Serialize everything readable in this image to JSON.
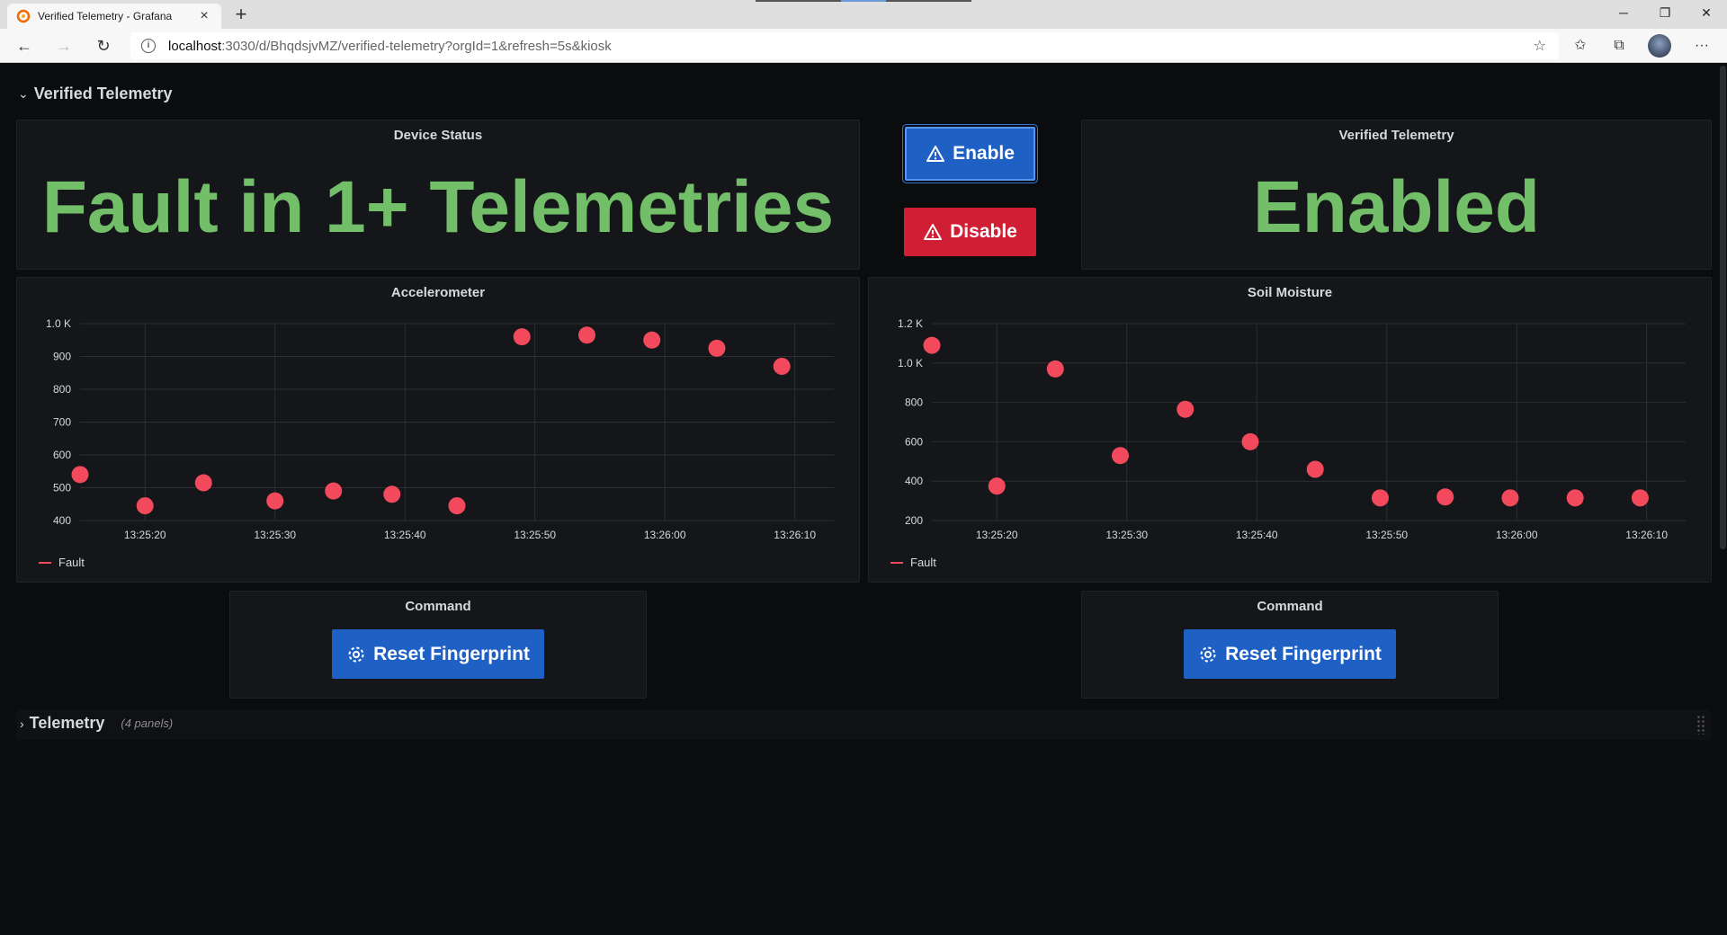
{
  "browser": {
    "tab_title": "Verified Telemetry - Grafana",
    "url_host": "localhost",
    "url_path": ":3030/d/BhqdsjvMZ/verified-telemetry?orgId=1&refresh=5s&kiosk"
  },
  "dashboard": {
    "row1_title": "Verified Telemetry",
    "row2_title": "Telemetry",
    "row2_count": "(4 panels)"
  },
  "device_status": {
    "title": "Device Status",
    "value": "Fault in 1+ Telemetries"
  },
  "buttons": {
    "enable": "Enable",
    "disable": "Disable"
  },
  "verified_telemetry": {
    "title": "Verified Telemetry",
    "value": "Enabled"
  },
  "command_left": {
    "title": "Command",
    "button": "Reset Fingerprint"
  },
  "command_right": {
    "title": "Command",
    "button": "Reset Fingerprint"
  },
  "colors": {
    "fault": "#f2495c",
    "stat_green": "#73bf69",
    "blue": "#1f60c4",
    "red": "#d01f35"
  },
  "chart_data": [
    {
      "type": "scatter",
      "title": "Accelerometer",
      "x_ticks": [
        "13:25:20",
        "13:25:30",
        "13:25:40",
        "13:25:50",
        "13:26:00",
        "13:26:10"
      ],
      "y_ticks": [
        "400",
        "500",
        "600",
        "700",
        "800",
        "900",
        "1.0 K"
      ],
      "ylim": [
        400,
        1000
      ],
      "xlim_seconds": [
        15,
        73
      ],
      "legend": "Fault",
      "series": [
        {
          "name": "Fault",
          "x": [
            15,
            20,
            24.5,
            30,
            34.5,
            39,
            44,
            49,
            54,
            59,
            64,
            69
          ],
          "y": [
            540,
            445,
            515,
            460,
            490,
            480,
            445,
            960,
            965,
            950,
            925,
            870
          ]
        }
      ]
    },
    {
      "type": "scatter",
      "title": "Soil Moisture",
      "x_ticks": [
        "13:25:20",
        "13:25:30",
        "13:25:40",
        "13:25:50",
        "13:26:00",
        "13:26:10"
      ],
      "y_ticks": [
        "200",
        "400",
        "600",
        "800",
        "1.0 K",
        "1.2 K"
      ],
      "ylim": [
        200,
        1200
      ],
      "xlim_seconds": [
        15,
        73
      ],
      "legend": "Fault",
      "series": [
        {
          "name": "Fault",
          "x": [
            15,
            20,
            24.5,
            29.5,
            34.5,
            39.5,
            44.5,
            49.5,
            54.5,
            59.5,
            64.5,
            69.5
          ],
          "y": [
            1090,
            375,
            970,
            530,
            765,
            600,
            460,
            315,
            320,
            315,
            315,
            315
          ]
        }
      ]
    }
  ]
}
